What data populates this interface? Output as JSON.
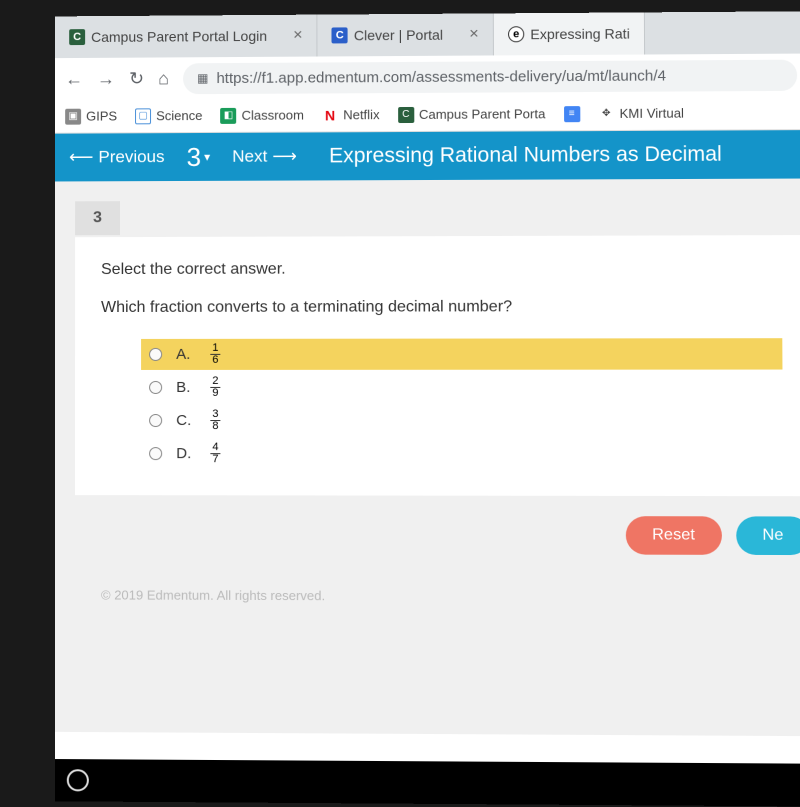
{
  "tabs": [
    {
      "label": "Campus Parent Portal Login",
      "icon": "C"
    },
    {
      "label": "Clever | Portal",
      "icon": "C"
    },
    {
      "label": "Expressing Rati",
      "icon": "e"
    }
  ],
  "url": "https://f1.app.edmentum.com/assessments-delivery/ua/mt/launch/4",
  "bookmarks": [
    {
      "label": "GIPS"
    },
    {
      "label": "Science"
    },
    {
      "label": "Classroom"
    },
    {
      "label": "Netflix"
    },
    {
      "label": "Campus Parent Porta"
    },
    {
      "label": "KMI Virtual"
    }
  ],
  "nav": {
    "prev": "Previous",
    "num": "3",
    "next": "Next",
    "title": "Expressing Rational Numbers as Decimal"
  },
  "question": {
    "number": "3",
    "instruction": "Select the correct answer.",
    "prompt": "Which fraction converts to a terminating decimal number?",
    "options": [
      {
        "letter": "A.",
        "num": "1",
        "den": "6",
        "highlighted": true
      },
      {
        "letter": "B.",
        "num": "2",
        "den": "9",
        "highlighted": false
      },
      {
        "letter": "C.",
        "num": "3",
        "den": "8",
        "highlighted": false
      },
      {
        "letter": "D.",
        "num": "4",
        "den": "7",
        "highlighted": false
      }
    ]
  },
  "buttons": {
    "reset": "Reset",
    "next": "Ne"
  },
  "footer": "© 2019 Edmentum. All rights reserved."
}
